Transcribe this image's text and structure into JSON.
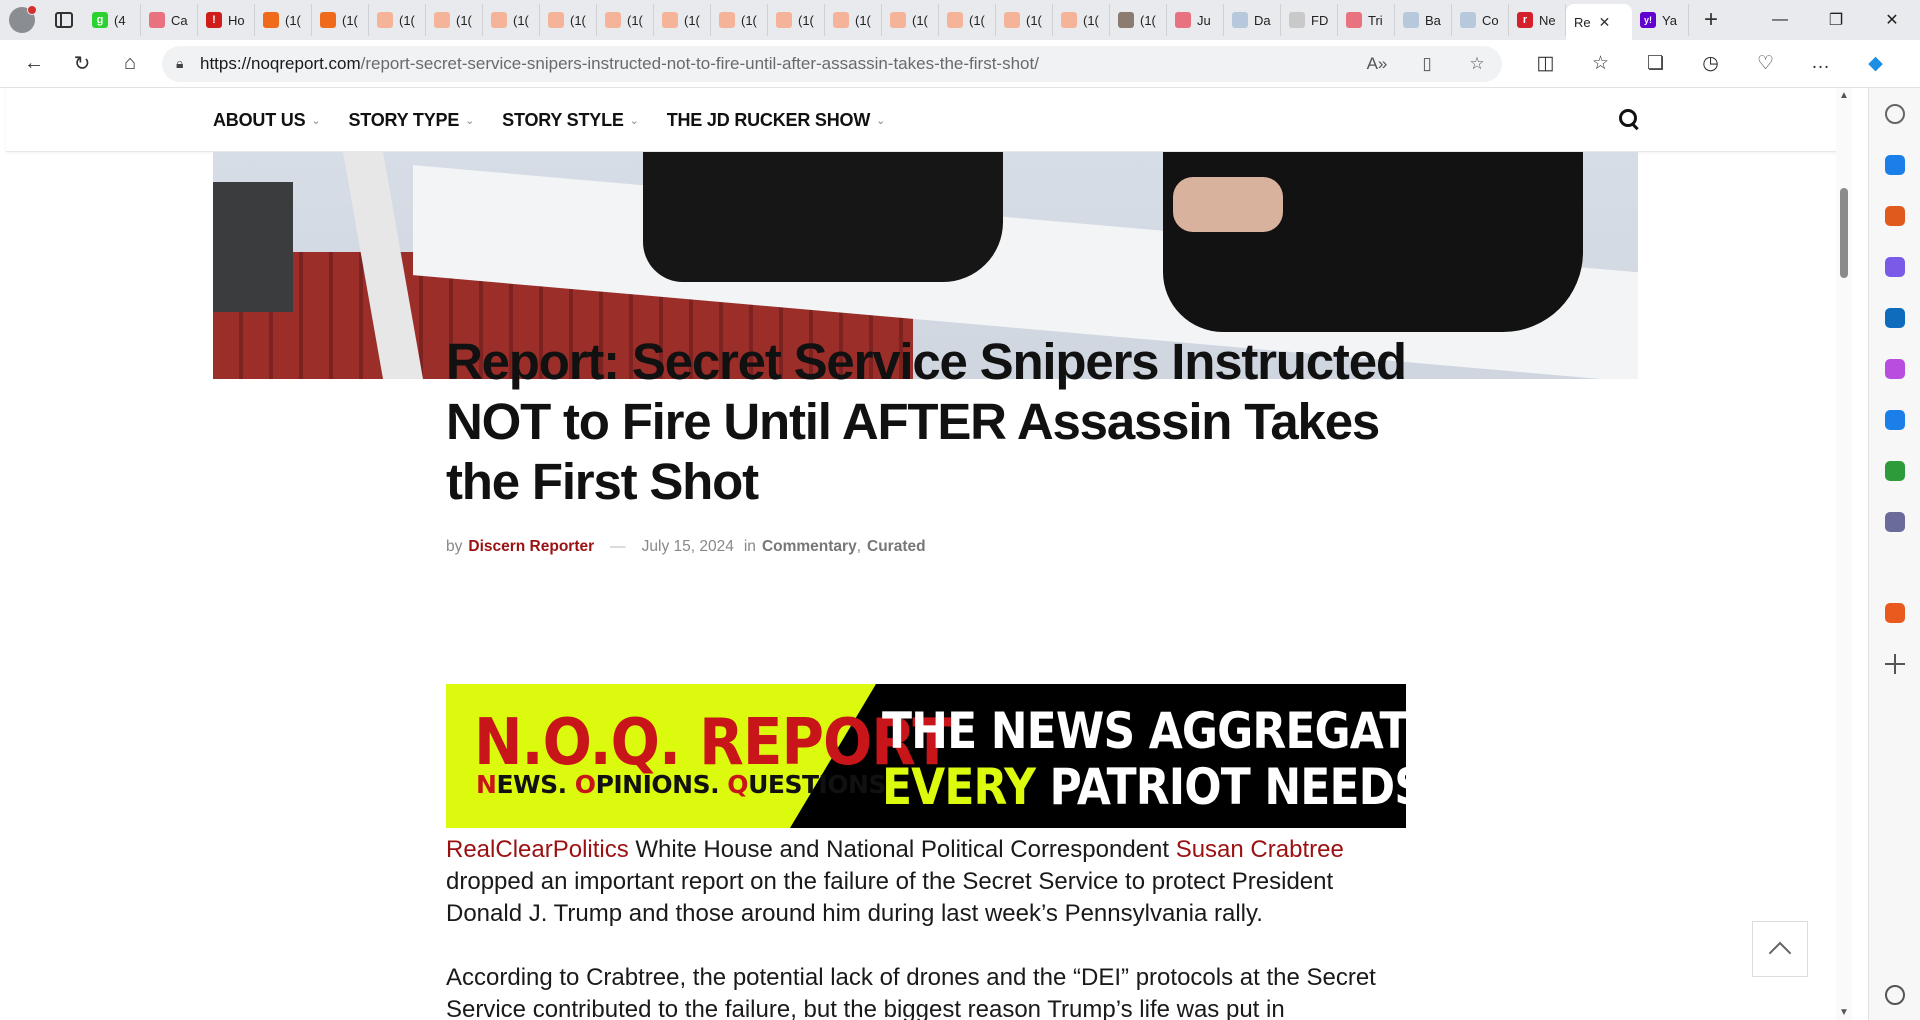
{
  "browser": {
    "tabs": [
      {
        "label": "(4",
        "color": "#2bd12f",
        "glyph": "g"
      },
      {
        "label": "Ca",
        "color": "#e8727f",
        "glyph": ""
      },
      {
        "label": "Ho",
        "color": "#d11c1c",
        "glyph": "!"
      },
      {
        "label": "(1(",
        "color": "#f06a1c",
        "glyph": ""
      },
      {
        "label": "(1(",
        "color": "#f06a1c",
        "glyph": ""
      },
      {
        "label": "(1(",
        "color": "#f5b49a",
        "glyph": ""
      },
      {
        "label": "(1(",
        "color": "#f5b49a",
        "glyph": ""
      },
      {
        "label": "(1(",
        "color": "#f5b49a",
        "glyph": ""
      },
      {
        "label": "(1(",
        "color": "#f5b49a",
        "glyph": ""
      },
      {
        "label": "(1(",
        "color": "#f5b49a",
        "glyph": ""
      },
      {
        "label": "(1(",
        "color": "#f5b49a",
        "glyph": ""
      },
      {
        "label": "(1(",
        "color": "#f5b49a",
        "glyph": ""
      },
      {
        "label": "(1(",
        "color": "#f5b49a",
        "glyph": ""
      },
      {
        "label": "(1(",
        "color": "#f5b49a",
        "glyph": ""
      },
      {
        "label": "(1(",
        "color": "#f5b49a",
        "glyph": ""
      },
      {
        "label": "(1(",
        "color": "#f5b49a",
        "glyph": ""
      },
      {
        "label": "(1(",
        "color": "#f5b49a",
        "glyph": ""
      },
      {
        "label": "(1(",
        "color": "#f5b49a",
        "glyph": ""
      },
      {
        "label": "(1(",
        "color": "#8c7b70",
        "glyph": ""
      },
      {
        "label": "Ju",
        "color": "#e8727f",
        "glyph": ""
      },
      {
        "label": "Da",
        "color": "#b8c8dc",
        "glyph": ""
      },
      {
        "label": "FD",
        "color": "#c9c9c9",
        "glyph": ""
      },
      {
        "label": "Tri",
        "color": "#e8727f",
        "glyph": ""
      },
      {
        "label": "Ba",
        "color": "#b8c8dc",
        "glyph": ""
      },
      {
        "label": "Co",
        "color": "#b8c8dc",
        "glyph": ""
      },
      {
        "label": "Ne",
        "color": "#d4202a",
        "glyph": "r"
      }
    ],
    "active_tab": {
      "label": "Re",
      "close": "✕"
    },
    "tab_after": {
      "label": "Ya",
      "color": "#6001d2",
      "glyph": "y!"
    },
    "new_tab": "+",
    "window_controls": {
      "minimize": "—",
      "restore": "❐",
      "close": "✕"
    },
    "url_host": "https://noqreport.com",
    "url_path": "/report-secret-service-snipers-instructed-not-to-fire-until-after-assassin-takes-the-first-shot/"
  },
  "nav": {
    "items": [
      {
        "label": "ABOUT US"
      },
      {
        "label": "STORY TYPE"
      },
      {
        "label": "STORY STYLE"
      },
      {
        "label": "THE JD RUCKER SHOW"
      }
    ]
  },
  "article": {
    "title": "Report: Secret Service Snipers Instructed NOT to Fire Until AFTER Assassin Takes the First Shot",
    "by": "by",
    "author": "Discern Reporter",
    "dash": "—",
    "date": "July 15, 2024",
    "in": "in",
    "category1": "Commentary",
    "comma": ",",
    "category2": "Curated",
    "banner": {
      "brand": "N.O.Q. REPORT",
      "tag_n": "N",
      "tag_1": "EWS. ",
      "tag_o": "O",
      "tag_2": "PINIONS. ",
      "tag_q": "Q",
      "tag_3": "UESTIONS.",
      "line1": "THE NEWS AGGREGATOR",
      "line2_a": "EVERY",
      "line2_b": " PATRIOT NEEDS"
    },
    "p1_link1": "RealClearPolitics",
    "p1_text1": " White House and National Political Correspondent ",
    "p1_link2": "Susan Crabtree",
    "p1_text2": " dropped an important report on the failure of the Secret Service to protect President Donald J. Trump and those around him during last week’s Pennsylvania rally.",
    "p2": "According to Crabtree, the potential lack of drones and the “DEI” protocols at the Secret Service contributed to the failure, but the biggest reason Trump’s life was put in"
  },
  "colors": {
    "accent": "#9b1112",
    "banner_green": "#dcfa0e",
    "banner_red": "#c8151a"
  },
  "sidebar_icons": [
    "search-icon",
    "tag-icon",
    "briefcase-icon",
    "copilot-icon",
    "outlook-icon",
    "designer-icon",
    "send-icon",
    "tree-icon",
    "games-icon",
    "bookmark-icon",
    "add-icon",
    "settings-icon"
  ]
}
